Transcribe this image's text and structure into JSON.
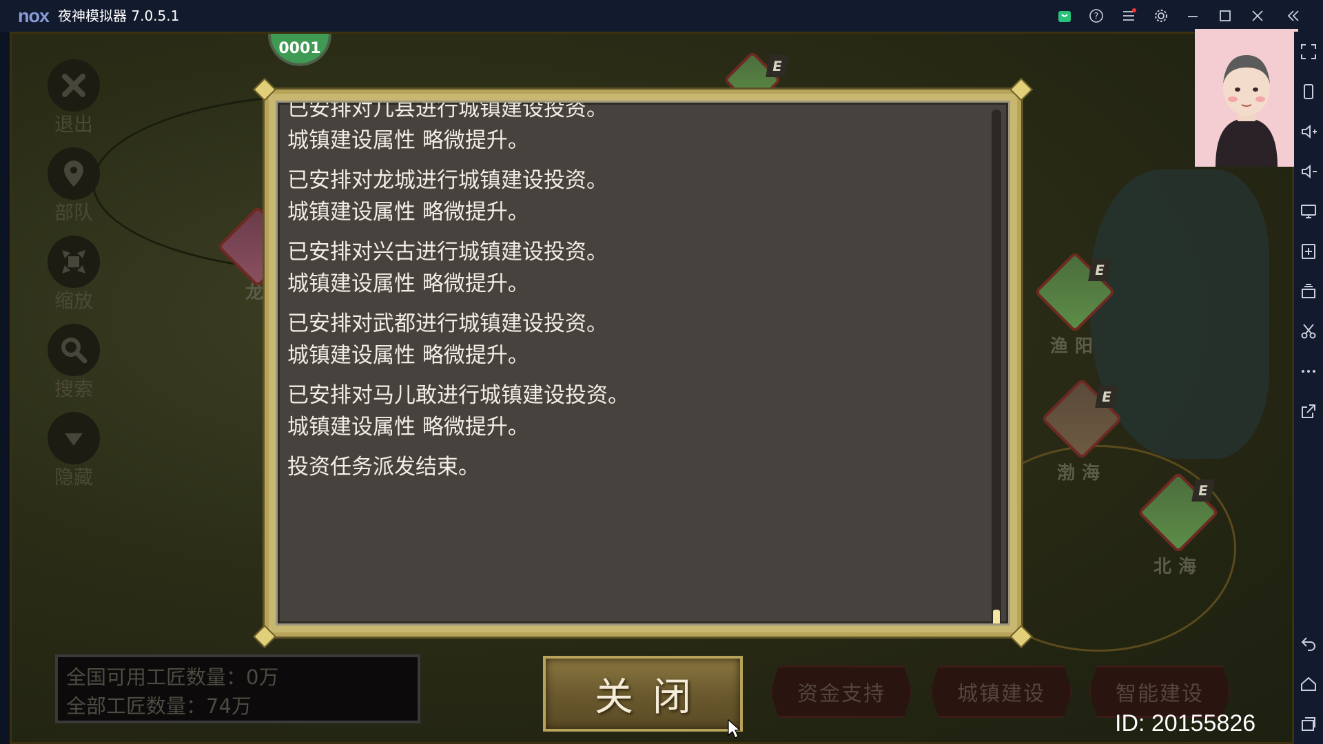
{
  "titlebar": {
    "logo": "nox",
    "title": "夜神模拟器 7.0.5.1"
  },
  "game": {
    "left_tools": [
      {
        "label": "退出",
        "icon": "close-x-icon"
      },
      {
        "label": "部队",
        "icon": "location-pin-icon"
      },
      {
        "label": "缩放",
        "icon": "expand-arrows-icon"
      },
      {
        "label": "搜索",
        "icon": "search-icon"
      },
      {
        "label": "隐藏",
        "icon": "chevron-down-icon"
      }
    ],
    "green_badge": "0001",
    "cities": [
      {
        "name": "龙",
        "badge": ""
      },
      {
        "name": "渔阳",
        "badge": "E"
      },
      {
        "name": "渤海",
        "badge": "E"
      },
      {
        "name": "北海",
        "badge": "E"
      }
    ],
    "top_city_badge": "E",
    "stats": {
      "available_artisans": "全国可用工匠数量：0万",
      "total_artisans": "全部工匠数量：74万"
    },
    "buttons": {
      "close": "关闭",
      "fund_support": "资金支持",
      "town_build": "城镇建设",
      "smart_build": "智能建设"
    },
    "id_text": "ID: 20155826"
  },
  "dialog": {
    "entries": [
      {
        "line1": "已安排对几县进行城镇建设投资。",
        "line2": "城镇建设属性 略微提升。"
      },
      {
        "line1": "已安排对龙城进行城镇建设投资。",
        "line2": "城镇建设属性 略微提升。"
      },
      {
        "line1": "已安排对兴古进行城镇建设投资。",
        "line2": "城镇建设属性 略微提升。"
      },
      {
        "line1": "已安排对武都进行城镇建设投资。",
        "line2": "城镇建设属性 略微提升。"
      },
      {
        "line1": "已安排对马儿敢进行城镇建设投资。",
        "line2": "城镇建设属性 略微提升。"
      }
    ],
    "final_line": "投资任务派发结束。"
  }
}
